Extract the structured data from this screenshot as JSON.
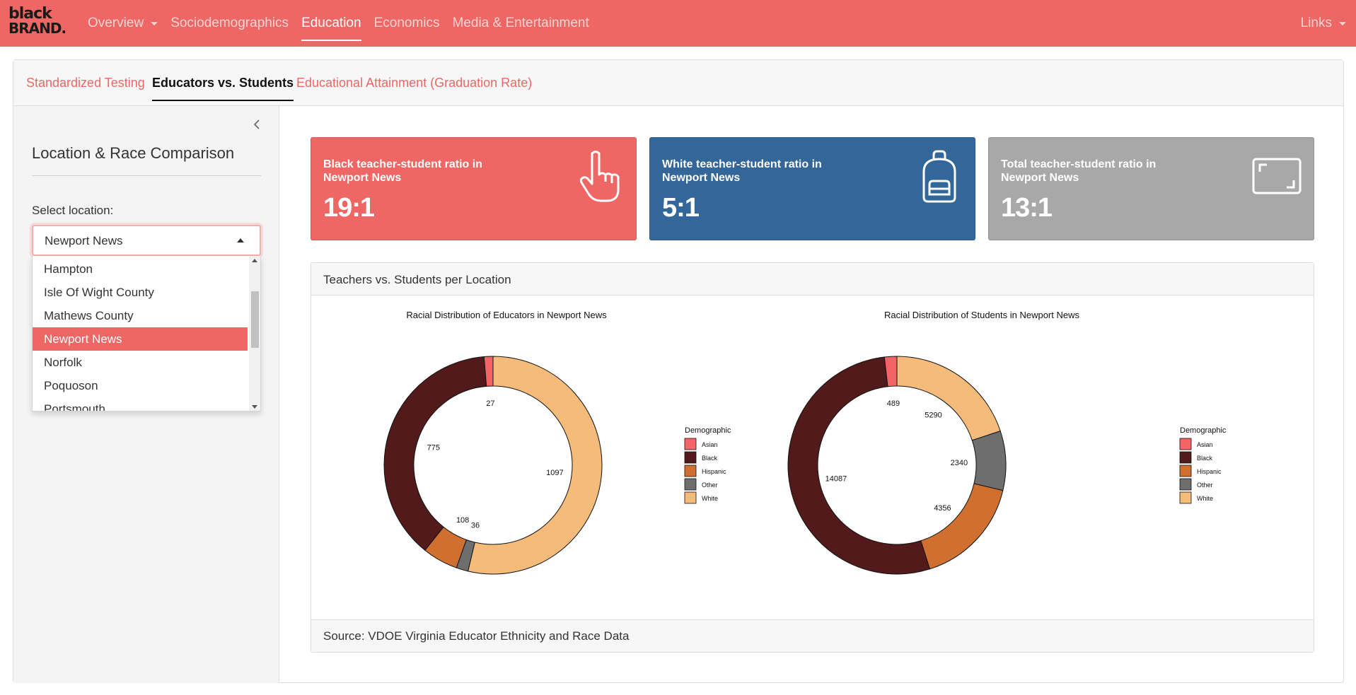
{
  "navbar": {
    "brand_line1": "black",
    "brand_line2": "BRAND.",
    "items": [
      {
        "label": "Overview",
        "dropdown": true
      },
      {
        "label": "Sociodemographics"
      },
      {
        "label": "Education",
        "active": true
      },
      {
        "label": "Economics"
      },
      {
        "label": "Media & Entertainment"
      }
    ],
    "links_label": "Links"
  },
  "tabs": [
    {
      "label": "Standardized Testing"
    },
    {
      "label": "Educators vs. Students",
      "active": true
    },
    {
      "label": "Educational Attainment (Graduation Rate)"
    }
  ],
  "sidebar": {
    "collapse_icon": "chevron-left-icon",
    "title": "Location & Race Comparison",
    "select_label": "Select location:",
    "select_value": "Newport News",
    "options": [
      "Hampton",
      "Isle Of Wight County",
      "Mathews County",
      "Newport News",
      "Norfolk",
      "Poquoson",
      "Portsmouth"
    ],
    "selected_option": "Newport News"
  },
  "value_boxes": [
    {
      "title": "Black teacher-student ratio in Newport News",
      "value": "19:1",
      "color": "#ee6764",
      "icon": "hand-pointer-icon"
    },
    {
      "title": "White teacher-student ratio in Newport News",
      "value": "5:1",
      "color": "#336699",
      "icon": "backpack-icon"
    },
    {
      "title": "Total teacher-student ratio in Newport News",
      "value": "13:1",
      "color": "#a8a8a8",
      "icon": "expand-icon"
    }
  ],
  "panel": {
    "title": "Teachers vs. Students per Location",
    "source": "Source: VDOE Virginia Educator Ethnicity and Race Data"
  },
  "chart_data": [
    {
      "type": "pie",
      "title": "Racial Distribution of Educators in Newport News",
      "legend_title": "Demographic",
      "legend_position": "right",
      "categories": [
        "Asian",
        "Black",
        "Hispanic",
        "Other",
        "White"
      ],
      "colors": [
        "#f26465",
        "#521a1a",
        "#d07030",
        "#6e6e6e",
        "#f4bb7a"
      ],
      "slices": [
        {
          "name": "White",
          "value": 1097
        },
        {
          "name": "Other",
          "value": 36
        },
        {
          "name": "Hispanic",
          "value": 108
        },
        {
          "name": "Black",
          "value": 775
        },
        {
          "name": "Asian",
          "value": 27
        }
      ],
      "data_labels": {
        "Asian": "27",
        "Black": "775",
        "Hispanic": "108",
        "Other": "36",
        "White": "1097"
      }
    },
    {
      "type": "pie",
      "title": "Racial Distribution of Students in Newport News",
      "legend_title": "Demographic",
      "legend_position": "right",
      "categories": [
        "Asian",
        "Black",
        "Hispanic",
        "Other",
        "White"
      ],
      "colors": [
        "#f26465",
        "#521a1a",
        "#d07030",
        "#6e6e6e",
        "#f4bb7a"
      ],
      "slices": [
        {
          "name": "White",
          "value": 5290
        },
        {
          "name": "Other",
          "value": 2340
        },
        {
          "name": "Hispanic",
          "value": 4356
        },
        {
          "name": "Black",
          "value": 14087
        },
        {
          "name": "Asian",
          "value": 489
        }
      ],
      "data_labels": {
        "Asian": "489",
        "Black": "14087",
        "Hispanic": "4356",
        "Other": "2340",
        "White": "5290"
      }
    }
  ]
}
